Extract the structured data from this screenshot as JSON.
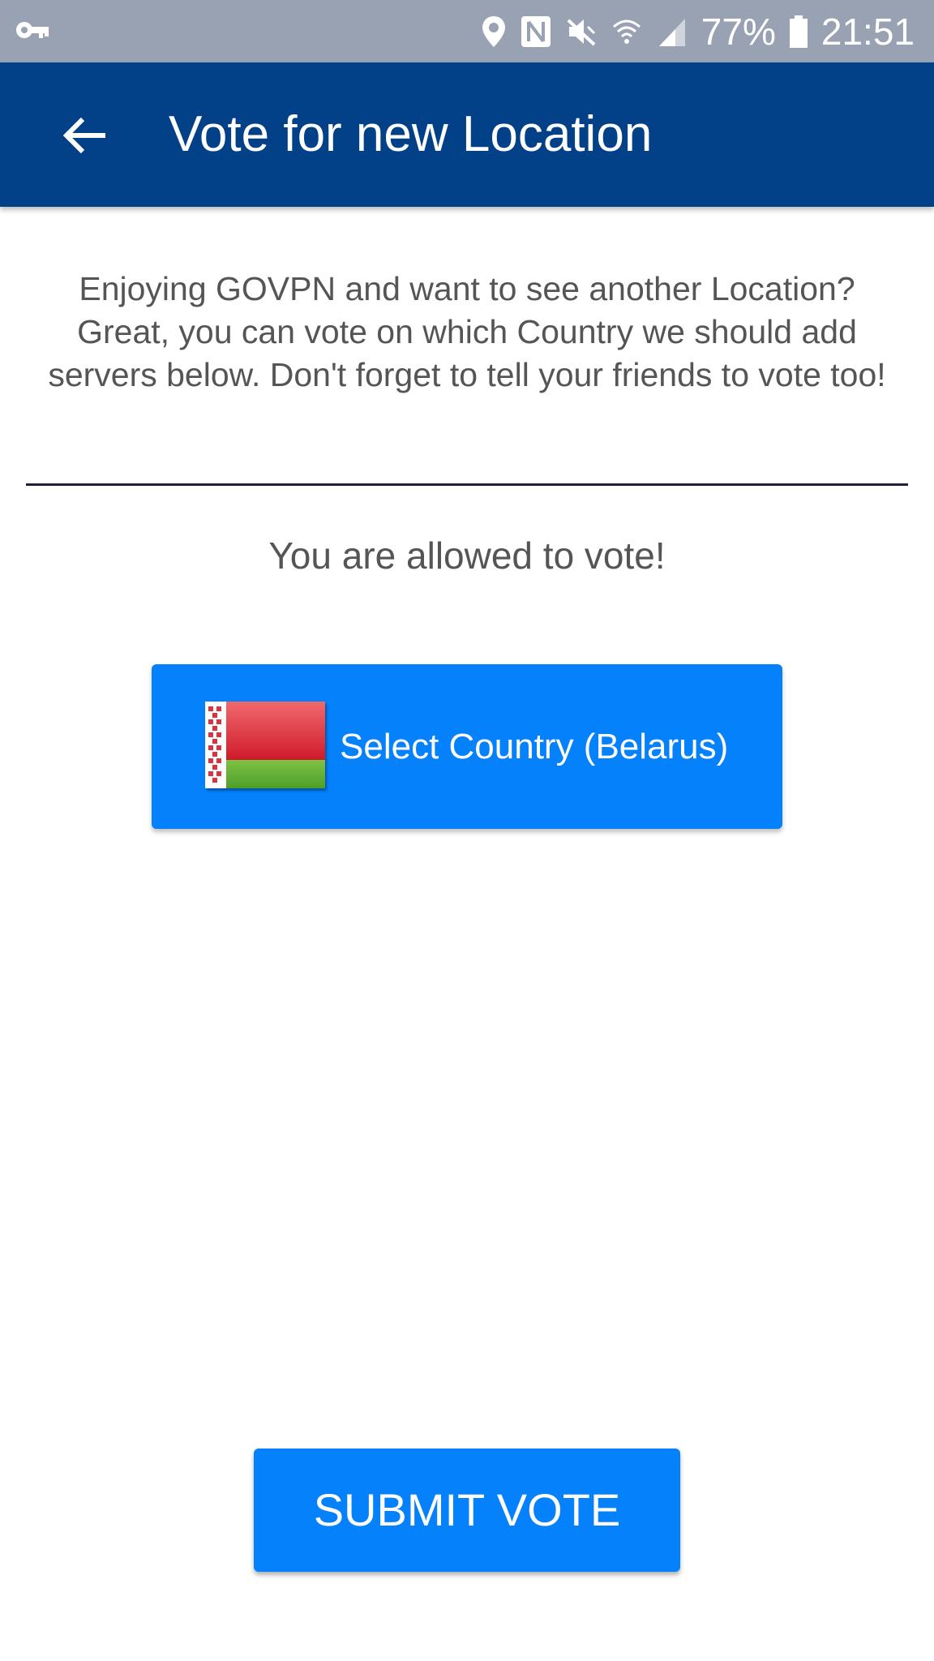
{
  "status_bar": {
    "battery": "77%",
    "time": "21:51",
    "icons": [
      "vpn-key-icon",
      "location-pin-icon",
      "nfc-icon",
      "mute-icon",
      "wifi-icon",
      "signal-icon",
      "battery-icon"
    ]
  },
  "app_bar": {
    "title": "Vote for new Location",
    "back_icon": "arrow-left-icon",
    "color": "#024088"
  },
  "content": {
    "intro": "Enjoying GOVPN and want to see another Location? Great, you can vote on which Country we should add servers below. Don't forget to tell your friends to vote too!",
    "vote_status": "You are allowed to vote!",
    "select_country_label": "Select Country (Belarus)",
    "selected_country_flag": "belarus-flag-icon",
    "submit_label": "SUBMIT VOTE",
    "accent_color": "#0581fc"
  }
}
